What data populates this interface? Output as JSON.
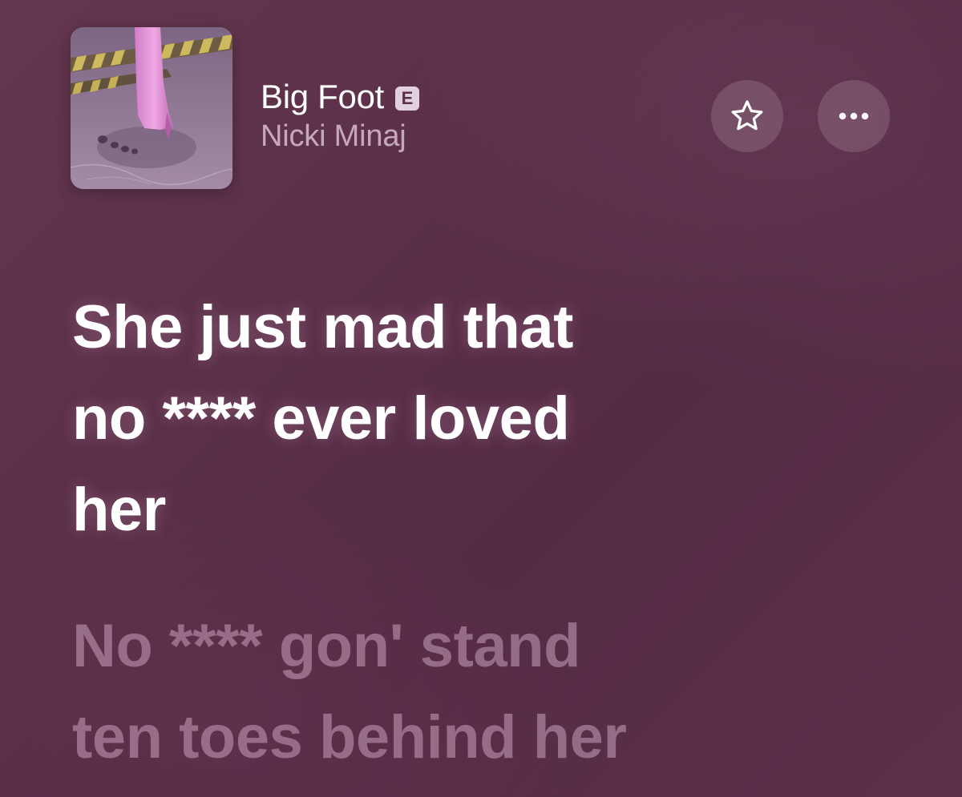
{
  "now_playing": {
    "title": "Big Foot",
    "explicit_badge": "E",
    "artist": "Nicki Minaj",
    "artwork_icon": "album-artwork-boot-footprint"
  },
  "actions": {
    "favorite_icon": "star-outline-icon",
    "more_icon": "ellipsis-icon"
  },
  "lyrics": {
    "current_line": "She just mad that\nno **** ever loved\nher",
    "next_line": "No **** gon' stand\nten toes behind her"
  },
  "colors": {
    "background": "#5b3048",
    "active_lyric": "#ffffff",
    "inactive_lyric": "#a37f97",
    "badge": "#e2cfe0"
  }
}
